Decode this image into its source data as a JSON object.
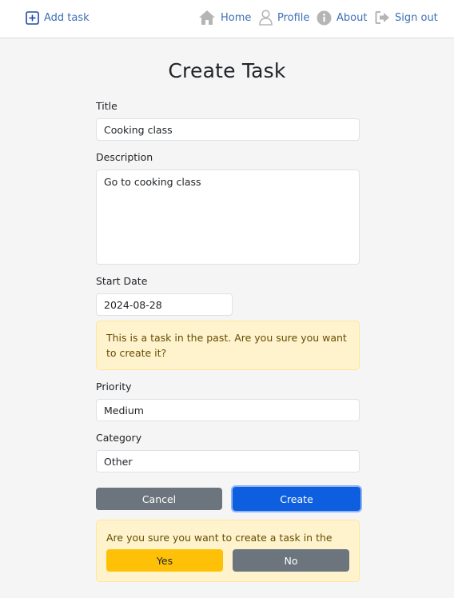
{
  "nav": {
    "add_task": "Add task",
    "home": "Home",
    "profile": "Profile",
    "about": "About",
    "sign_out": "Sign out",
    "link_color": "#3d6fb6",
    "icon_color": "#b5b5b5"
  },
  "form": {
    "title": "Create Task",
    "title_label": "Title",
    "title_value": "Cooking class",
    "description_label": "Description",
    "description_value": "Go to cooking class",
    "start_date_label": "Start Date",
    "start_date_value": "2024-08-28",
    "past_warning": "This is a task in the past. Are you sure you want to create it?",
    "priority_label": "Priority",
    "priority_value": "Medium",
    "category_label": "Category",
    "category_value": "Other",
    "cancel_label": "Cancel",
    "create_label": "Create"
  },
  "confirm": {
    "message": "Are you sure you want to create a task in the past?",
    "yes_label": "Yes",
    "no_label": "No",
    "warning_bg": "#fff3cd",
    "yes_color": "#ffc107",
    "no_color": "#6c757d"
  },
  "colors": {
    "primary": "#0d5fe0",
    "secondary": "#6c757d",
    "page_bg": "#f5f5f5"
  }
}
